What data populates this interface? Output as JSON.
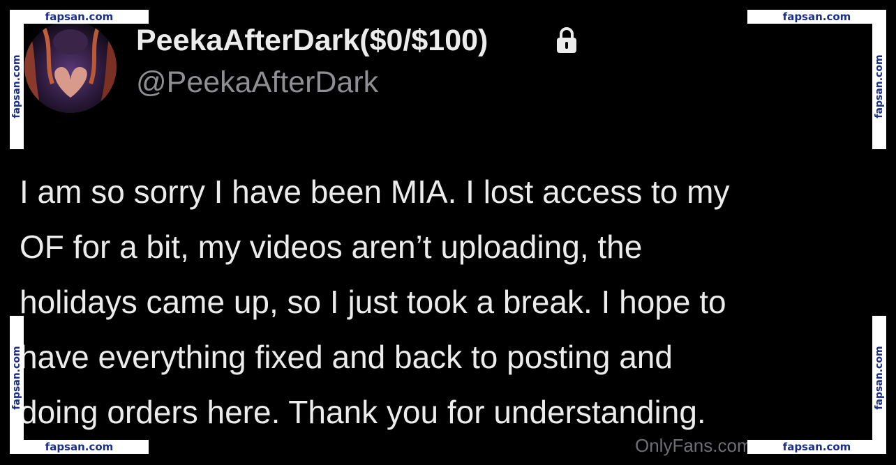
{
  "post": {
    "display_name": "PeekaAfterDark($0/$100)",
    "handle": "@PeekaAfterDark",
    "lock_icon": "lock-icon",
    "body_lines": [
      "I am so sorry I have been MIA. I lost access to my",
      "OF for a bit, my videos aren’t uploading, the",
      "holidays came up, so I just took a break. I hope to",
      "have everything fixed and back to posting and",
      "doing orders here. Thank you for understanding."
    ],
    "source_label": "OnlyFans.com"
  },
  "watermark": {
    "text": "fapsan.com",
    "color": "#1a2e8a"
  },
  "colors": {
    "background": "#000000",
    "text": "#ececec",
    "handle": "#8e8e93"
  }
}
